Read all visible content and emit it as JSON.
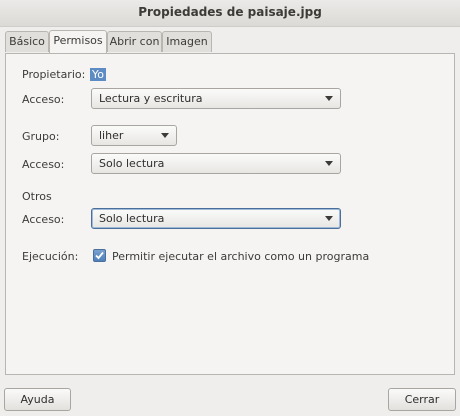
{
  "window": {
    "title": "Propiedades de paisaje.jpg"
  },
  "tabs": [
    {
      "label": "Básico"
    },
    {
      "label": "Permisos"
    },
    {
      "label": "Abrir con"
    },
    {
      "label": "Imagen"
    }
  ],
  "owner": {
    "label": "Propietario:",
    "value": "Yo"
  },
  "owner_access": {
    "label": "Acceso:",
    "value": "Lectura y escritura"
  },
  "group": {
    "label": "Grupo:",
    "value": "liher"
  },
  "group_access": {
    "label": "Acceso:",
    "value": "Solo lectura"
  },
  "others": {
    "heading": "Otros"
  },
  "others_access": {
    "label": "Acceso:",
    "value": "Solo lectura"
  },
  "execution": {
    "label": "Ejecución:",
    "checkbox_label": "Permitir ejecutar el archivo como un programa",
    "checked": true
  },
  "buttons": {
    "help": "Ayuda",
    "close": "Cerrar"
  }
}
